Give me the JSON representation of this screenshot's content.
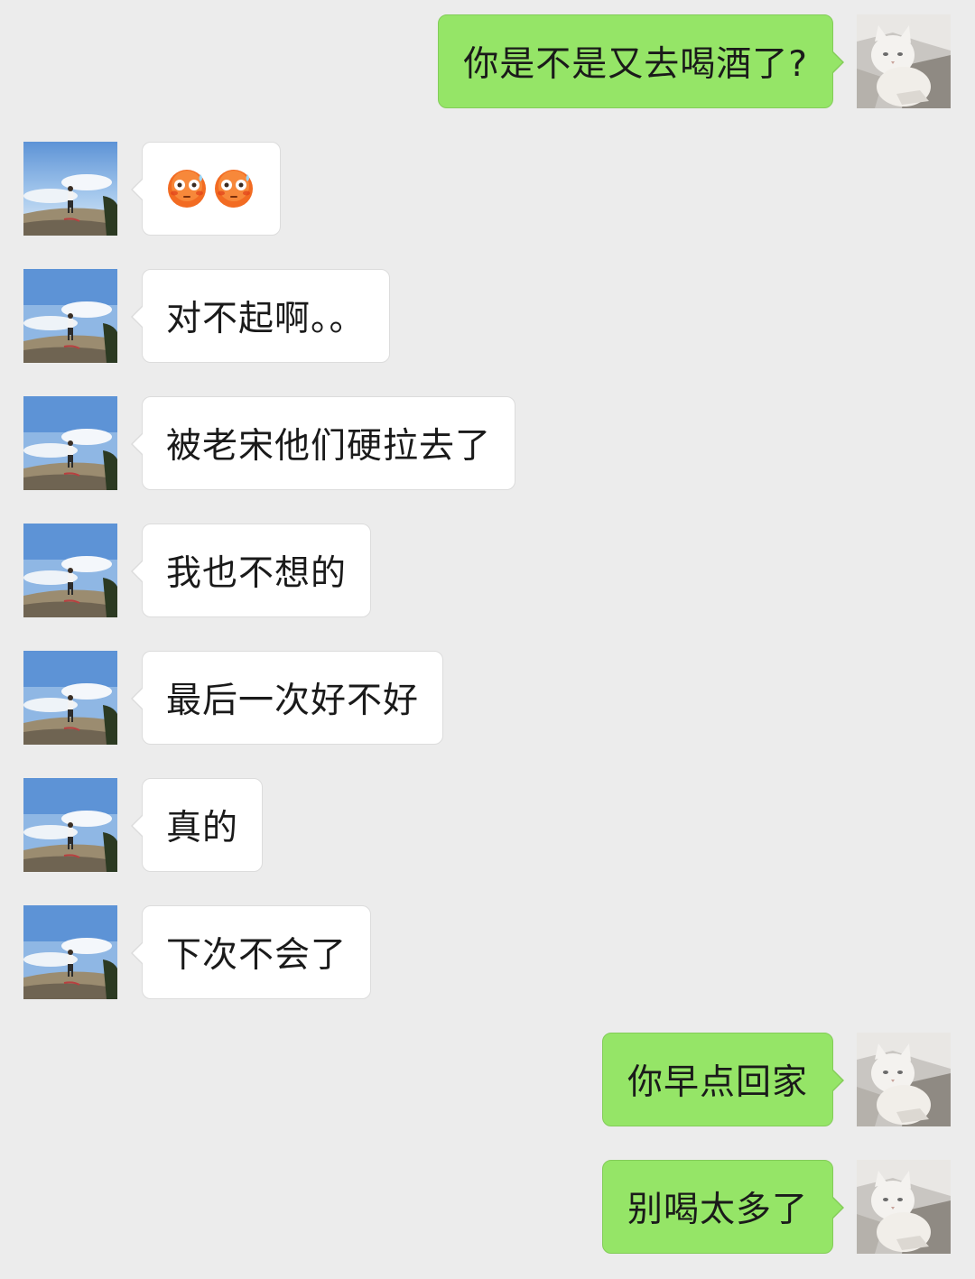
{
  "messages": [
    {
      "side": "right",
      "text": "你是不是又去喝酒了?"
    },
    {
      "side": "left",
      "emoji": [
        "flushed-face",
        "flushed-face"
      ]
    },
    {
      "side": "left",
      "text": "对不起啊。。"
    },
    {
      "side": "left",
      "text": "被老宋他们硬拉去了"
    },
    {
      "side": "left",
      "text": "我也不想的"
    },
    {
      "side": "left",
      "text": "最后一次好不好"
    },
    {
      "side": "left",
      "text": "真的"
    },
    {
      "side": "left",
      "text": "下次不会了"
    },
    {
      "side": "right",
      "text": "你早点回家"
    },
    {
      "side": "right",
      "text": "别喝太多了"
    }
  ],
  "avatars": {
    "sender": "cat-avatar",
    "contact": "person-on-hill-avatar"
  },
  "colors": {
    "background": "#ececec",
    "sent_bubble": "#95e567",
    "received_bubble": "#ffffff"
  }
}
